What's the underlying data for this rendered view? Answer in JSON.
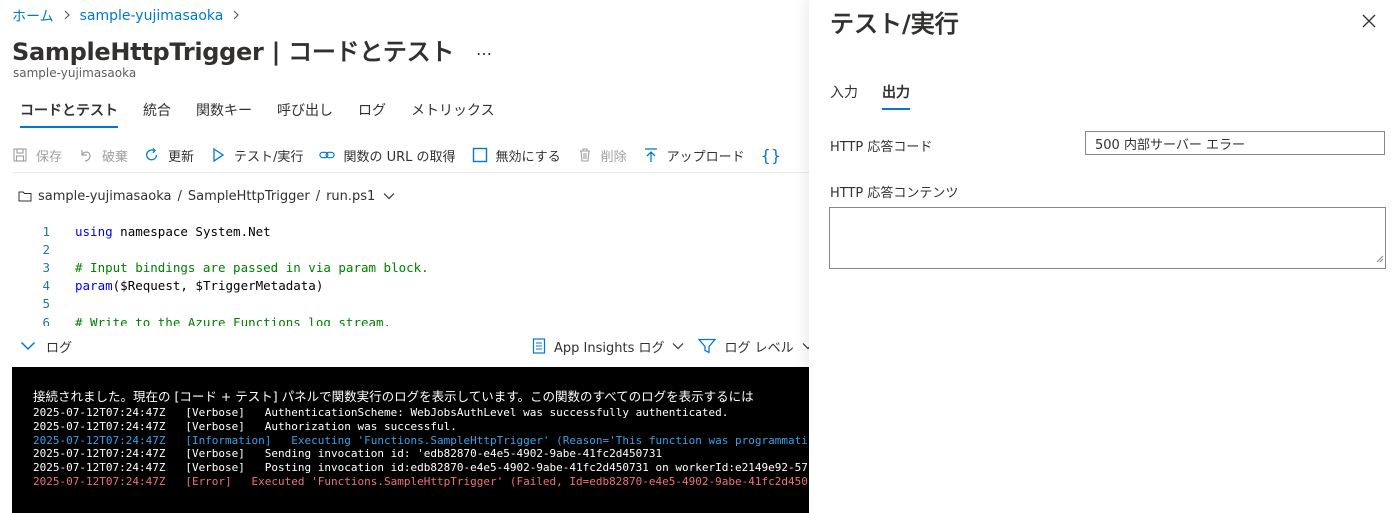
{
  "breadcrumb": {
    "home": "ホーム",
    "app": "sample-yujimasaoka"
  },
  "page": {
    "title": "SampleHttpTrigger | コードとテスト",
    "more": "…",
    "subtitle": "sample-yujimasaoka"
  },
  "tabs": [
    "コードとテスト",
    "統合",
    "関数キー",
    "呼び出し",
    "ログ",
    "メトリックス"
  ],
  "toolbar": {
    "save": "保存",
    "discard": "破棄",
    "refresh": "更新",
    "test_run": "テスト/実行",
    "get_url": "関数の URL の取得",
    "disable": "無効にする",
    "delete": "削除",
    "upload": "アップロード",
    "more_icon": "{}"
  },
  "filepath": {
    "app": "sample-yujimasaoka",
    "function": "SampleHttpTrigger",
    "file": "run.ps1",
    "sep": "/"
  },
  "code": [
    {
      "n": "1",
      "parts": [
        {
          "t": "kw",
          "v": "using"
        },
        {
          "t": "tx",
          "v": " namespace System.Net"
        }
      ]
    },
    {
      "n": "2",
      "parts": []
    },
    {
      "n": "3",
      "parts": [
        {
          "t": "cm",
          "v": "# Input bindings are passed in via param block."
        }
      ]
    },
    {
      "n": "4",
      "parts": [
        {
          "t": "kw",
          "v": "param"
        },
        {
          "t": "tx",
          "v": "($Request, $TriggerMetadata)"
        }
      ]
    },
    {
      "n": "5",
      "parts": []
    },
    {
      "n": "6",
      "parts": [
        {
          "t": "cm",
          "v": "# Write to the Azure Functions log stream."
        }
      ]
    }
  ],
  "logbar": {
    "label": "ログ",
    "app_insights": "App Insights ログ",
    "log_level": "ログ レベル"
  },
  "console": {
    "banner": "接続されました。現在の [コード + テスト] パネルで関数実行のログを表示しています。この関数のすべてのログを表示するには",
    "rows": [
      {
        "level": "verbose",
        "text": "2025-07-12T07:24:47Z   [Verbose]   AuthenticationScheme: WebJobsAuthLevel was successfully authenticated."
      },
      {
        "level": "verbose",
        "text": "2025-07-12T07:24:47Z   [Verbose]   Authorization was successful."
      },
      {
        "level": "info",
        "text": "2025-07-12T07:24:47Z   [Information]   Executing 'Functions.SampleHttpTrigger' (Reason='This function was programmati"
      },
      {
        "level": "verbose",
        "text": "2025-07-12T07:24:47Z   [Verbose]   Sending invocation id: 'edb82870-e4e5-4902-9abe-41fc2d450731"
      },
      {
        "level": "verbose",
        "text": "2025-07-12T07:24:47Z   [Verbose]   Posting invocation id:edb82870-e4e5-4902-9abe-41fc2d450731 on workerId:e2149e92-57"
      },
      {
        "level": "error",
        "text": "2025-07-12T07:24:47Z   [Error]   Executed 'Functions.SampleHttpTrigger' (Failed, Id=edb82870-e4e5-4902-9abe-41fc2d450"
      }
    ]
  },
  "panel": {
    "title": "テスト/実行",
    "tabs": [
      "入力",
      "出力"
    ],
    "active_tab": "出力",
    "response_code_label": "HTTP 応答コード",
    "response_code_value": "500 内部サーバー エラー",
    "response_content_label": "HTTP 応答コンテンツ",
    "response_content_value": ""
  },
  "colors": {
    "accent": "#0078d4",
    "info_log": "#3aa0e8",
    "error_log": "#f1707b",
    "console_bg": "#000000"
  }
}
